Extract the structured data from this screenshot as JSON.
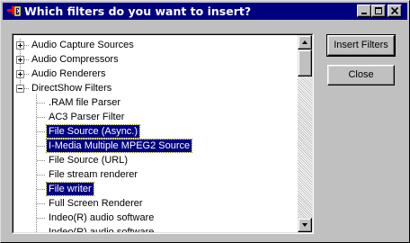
{
  "window": {
    "title": "Which filters do you want to insert?",
    "colors": {
      "titlebar": "#000080",
      "face": "#c0c0c0",
      "selection": "#000080"
    }
  },
  "title_buttons": {
    "minimize": "minimize-icon",
    "maximize": "maximize-icon",
    "close": "close-icon"
  },
  "tree": {
    "items": [
      {
        "label": "Audio Capture Sources",
        "level": 0,
        "expander": "plus"
      },
      {
        "label": "Audio Compressors",
        "level": 0,
        "expander": "plus"
      },
      {
        "label": "Audio Renderers",
        "level": 0,
        "expander": "plus"
      },
      {
        "label": "DirectShow Filters",
        "level": 0,
        "expander": "minus"
      },
      {
        "label": ".RAM file Parser",
        "level": 1,
        "selected": false
      },
      {
        "label": "AC3 Parser Filter",
        "level": 1,
        "selected": false
      },
      {
        "label": "File Source (Async.)",
        "level": 1,
        "selected": true
      },
      {
        "label": "I-Media Multiple MPEG2 Source",
        "level": 1,
        "selected": true
      },
      {
        "label": "File Source (URL)",
        "level": 1,
        "selected": false
      },
      {
        "label": "File stream renderer",
        "level": 1,
        "selected": false
      },
      {
        "label": "File writer",
        "level": 1,
        "selected": true
      },
      {
        "label": "Full Screen Renderer",
        "level": 1,
        "selected": false
      },
      {
        "label": "Indeo(R) audio software",
        "level": 1,
        "selected": false
      },
      {
        "label": "Indeo(R) audio software",
        "level": 1,
        "selected": false
      }
    ]
  },
  "buttons": {
    "insert_filters": "Insert Filters",
    "close": "Close"
  }
}
